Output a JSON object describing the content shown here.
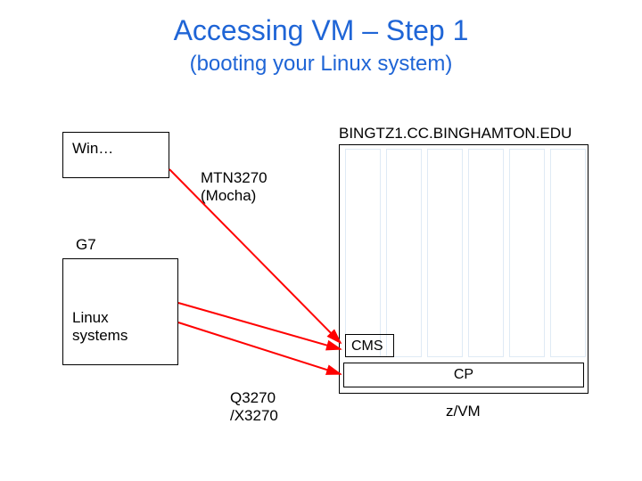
{
  "title": "Accessing VM – Step 1",
  "subtitle": "(booting your Linux system)",
  "host_label": "BINGTZ1.CC.BINGHAMTON.EDU",
  "win_box": "Win…",
  "g7_label": "G7",
  "linux_box": "Linux\nsystems",
  "mtn_label": "MTN3270\n(Mocha)",
  "q3270_label": "Q3270\n/X3270",
  "cms_label": "CMS",
  "cp_label": "CP",
  "zvm_label": "z/VM",
  "colors": {
    "title": "#1f65d6",
    "arrow": "#ff0000",
    "column_border": "#dfeaf5"
  }
}
